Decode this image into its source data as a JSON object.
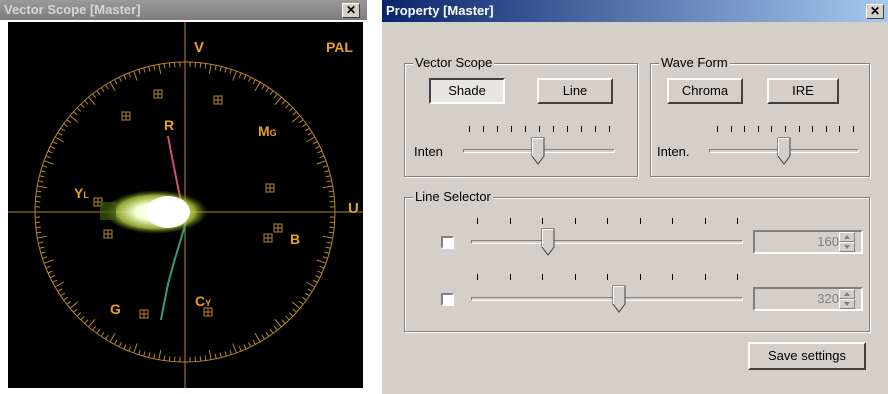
{
  "scope_window": {
    "title": "Vector Scope [Master]",
    "close_label": "✕",
    "labels": {
      "v": "V",
      "u": "U",
      "standard": "PAL"
    },
    "targets": [
      {
        "main": "R",
        "sub": ""
      },
      {
        "main": "M",
        "sub": "G"
      },
      {
        "main": "B",
        "sub": ""
      },
      {
        "main": "C",
        "sub": "Y"
      },
      {
        "main": "G",
        "sub": ""
      },
      {
        "main": "Y",
        "sub": "L"
      }
    ],
    "colors": {
      "graticule": "#b8862a",
      "label": "#e8a020",
      "trace_red": "#d05070",
      "trace_green": "#30a070"
    }
  },
  "property_window": {
    "title": "Property [Master]",
    "close_label": "✕",
    "vector_scope": {
      "label": "Vector Scope",
      "shade_label": "Shade",
      "line_label": "Line",
      "inten_label": "Inten",
      "inten_value": 0.5
    },
    "wave_form": {
      "label": "Wave Form",
      "chroma_label": "Chroma",
      "ire_label": "IRE",
      "inten_label": "Inten.",
      "inten_value": 0.5
    },
    "line_selector": {
      "label": "Line Selector",
      "rows": [
        {
          "checked": false,
          "value": "160",
          "position": 0.29
        },
        {
          "checked": false,
          "value": "320",
          "position": 0.57
        }
      ]
    },
    "save_label": "Save settings"
  }
}
